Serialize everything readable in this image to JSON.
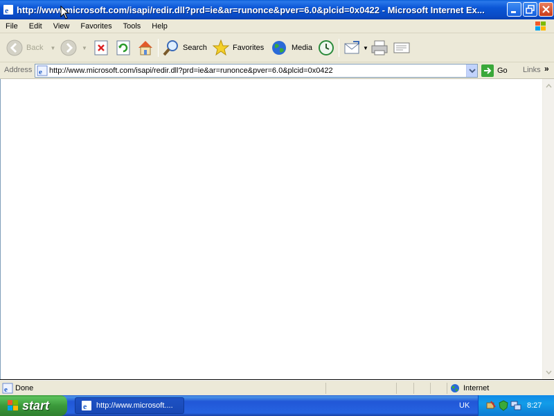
{
  "window": {
    "title": "http://www.microsoft.com/isapi/redir.dll?prd=ie&ar=runonce&pver=6.0&plcid=0x0422 - Microsoft Internet Ex..."
  },
  "menu": [
    "File",
    "Edit",
    "View",
    "Favorites",
    "Tools",
    "Help"
  ],
  "toolbar": {
    "back_label": "Back",
    "search_label": "Search",
    "favorites_label": "Favorites",
    "media_label": "Media"
  },
  "address": {
    "label": "Address",
    "value": "http://www.microsoft.com/isapi/redir.dll?prd=ie&ar=runonce&pver=6.0&plcid=0x0422",
    "go_label": "Go",
    "links_label": "Links"
  },
  "status": {
    "text": "Done",
    "zone": "Internet"
  },
  "taskbar": {
    "start_label": "start",
    "task_label": "http://www.microsoft....",
    "language": "UK",
    "clock": "8:27"
  }
}
